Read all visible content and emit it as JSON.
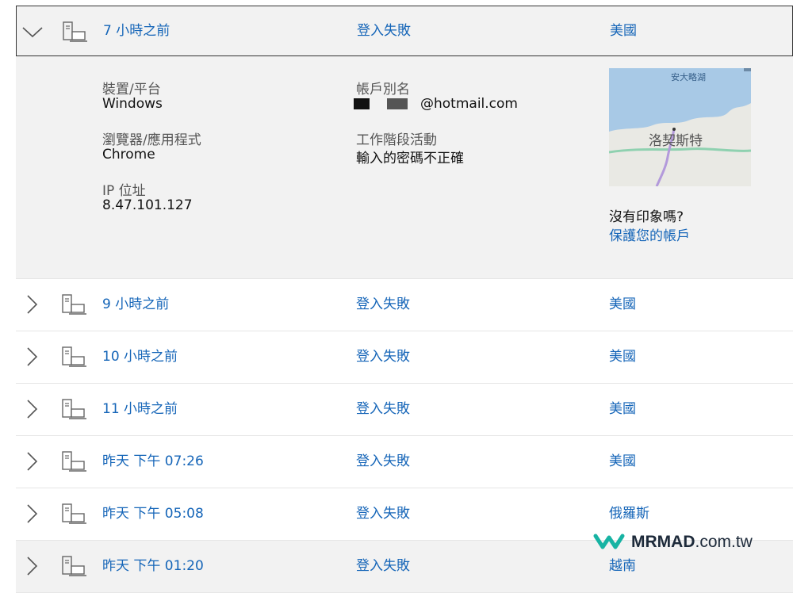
{
  "activity": {
    "expanded": {
      "time": "7 小時之前",
      "status": "登入失敗",
      "location": "美國",
      "device_label": "裝置/平台",
      "device_value": "Windows",
      "browser_label": "瀏覽器/應用程式",
      "browser_value": "Chrome",
      "ip_label": "IP 位址",
      "ip_value": "8.47.101.127",
      "alias_label": "帳戶別名",
      "alias_value": "@hotmail.com",
      "session_label": "工作階段活動",
      "session_value": "輸入的密碼不正確",
      "map_label_lake": "安大略湖",
      "map_label_city": "洛契斯特",
      "not_recognized": "沒有印象嗎?",
      "protect_link": "保護您的帳戶"
    },
    "rows": [
      {
        "time": "9 小時之前",
        "status": "登入失敗",
        "location": "美國"
      },
      {
        "time": "10 小時之前",
        "status": "登入失敗",
        "location": "美國"
      },
      {
        "time": "11 小時之前",
        "status": "登入失敗",
        "location": "美國"
      },
      {
        "time": "昨天 下午 07:26",
        "status": "登入失敗",
        "location": "美國"
      },
      {
        "time": "昨天 下午 05:08",
        "status": "登入失敗",
        "location": "俄羅斯"
      },
      {
        "time": "昨天 下午 01:20",
        "status": "登入失敗",
        "location": "越南"
      }
    ]
  },
  "watermark": {
    "brand": "MRMAD",
    "domain": ".com.tw"
  },
  "colors": {
    "link": "#1565b8",
    "panel": "#f2f2f2",
    "brand_teal": "#17b3a3",
    "brand_navy": "#1d2a3a"
  }
}
